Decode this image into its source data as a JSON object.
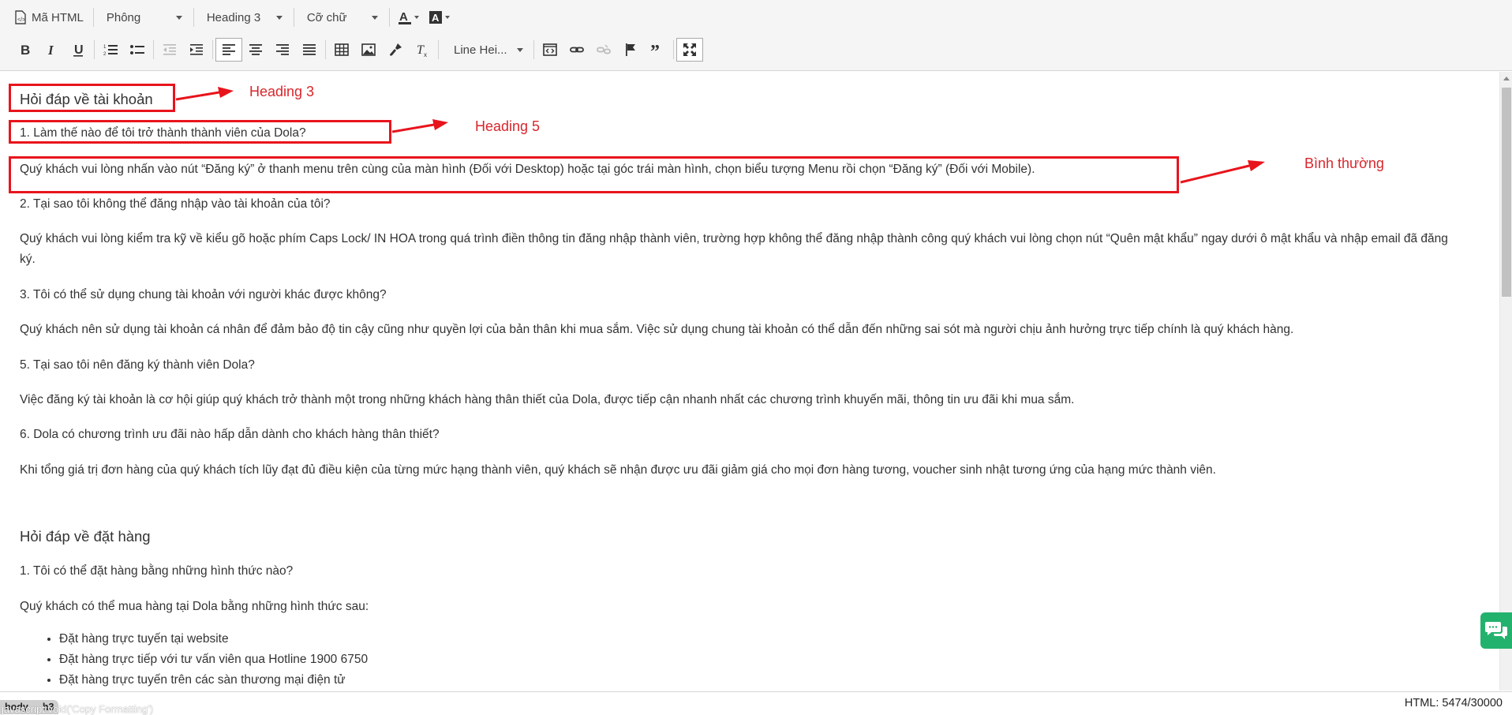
{
  "toolbar": {
    "source_label": "Mã HTML",
    "font_label": "Phông",
    "format_label": "Heading 3",
    "size_label": "Cỡ chữ",
    "line_height_label": "Line Hei..."
  },
  "content": {
    "section1_title": "Hỏi đáp về tài khoản",
    "q1": "1. Làm thế nào để tôi trở thành thành viên của Dola?",
    "a1": "Quý khách vui lòng nhấn vào nút “Đăng ký” ở thanh menu trên cùng của màn hình (Đối với Desktop) hoặc tại góc trái màn hình, chọn biểu tượng Menu rồi chọn “Đăng ký” (Đối với Mobile).",
    "q2": "2. Tại sao tôi không thể đăng nhập vào tài khoản của tôi?",
    "a2": "Quý khách vui lòng kiểm tra kỹ về kiểu gõ hoặc phím Caps Lock/ IN HOA trong quá trình điền thông tin đăng nhập thành viên, trường hợp không thể đăng nhập thành công quý khách vui lòng chọn nút “Quên mật khẩu” ngay dưới ô mật khẩu và nhập email đã đăng ký.",
    "q3": "3. Tôi có thể sử dụng chung tài khoản với người khác được không?",
    "a3": "Quý khách nên sử dụng tài khoản cá nhân để đảm bảo độ tin cậy cũng như quyền lợi của bản thân khi mua sắm. Việc sử dụng chung tài khoản có thể dẫn đến những sai sót mà người chịu ảnh hưởng trực tiếp chính là quý khách hàng.",
    "q5": "5. Tại sao tôi nên đăng ký thành viên Dola?",
    "a5": "Việc đăng ký tài khoản là cơ hội giúp quý khách trở thành một trong những khách hàng thân thiết của Dola, được tiếp cận nhanh nhất các chương trình khuyến mãi, thông tin ưu đãi khi mua sắm.",
    "q6": "6. Dola có chương trình ưu đãi nào hấp dẫn dành cho khách hàng thân thiết?",
    "a6": "Khi tổng giá trị đơn hàng của quý khách tích lũy đạt đủ điều kiện của từng mức hạng thành viên, quý khách sẽ nhận được ưu đãi giảm giá cho mọi đơn hàng tương, voucher sinh nhật tương ứng của hạng mức thành viên.",
    "section2_title": "Hỏi đáp về đặt hàng",
    "oq1": "1. Tôi có thể đặt hàng bằng những hình thức nào?",
    "oa1": "Quý khách có thể mua hàng tại Dola bằng những hình thức sau:",
    "list": [
      "Đặt hàng trực tuyến tại website",
      "Đặt hàng trực tiếp với tư vấn viên qua Hotline 1900 6750",
      "Đặt hàng trực tuyến trên các sàn thương mại điện tử"
    ]
  },
  "annotations": {
    "label1": "Heading 3",
    "label2": "Heading 5",
    "label3": "Bình thường",
    "color": "#e8141c"
  },
  "statusbar": {
    "path_body": "body",
    "path_h3": "h3",
    "tooltip": "javascript:void('Copy Formatting')",
    "html_count": "HTML: 5474/30000"
  }
}
